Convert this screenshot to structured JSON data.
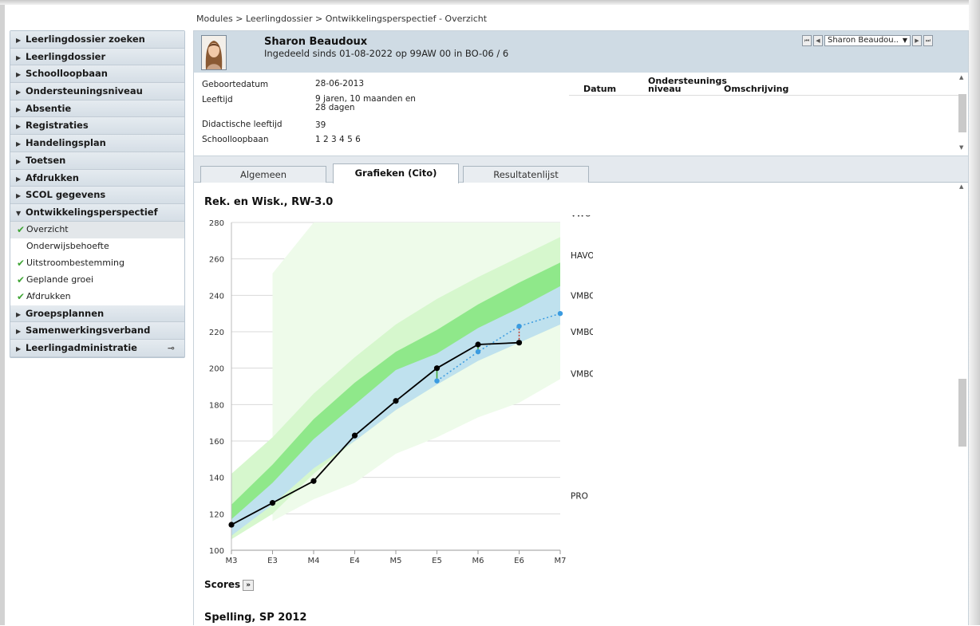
{
  "breadcrumb": "Modules > Leerlingdossier > Ontwikkelingsperspectief - Overzicht",
  "sidebar": {
    "items_top": [
      "Leerlingdossier zoeken",
      "Leerlingdossier",
      "Schoolloopbaan",
      "Ondersteuningsniveau",
      "Absentie",
      "Registraties",
      "Handelingsplan",
      "Toetsen",
      "Afdrukken",
      "SCOL gegevens"
    ],
    "expanded": "Ontwikkelingsperspectief",
    "sub_items": [
      {
        "label": "Overzicht",
        "checked": true,
        "active": true
      },
      {
        "label": "Onderwijsbehoefte",
        "checked": false,
        "active": false
      },
      {
        "label": "Uitstroombestemming",
        "checked": true,
        "active": false
      },
      {
        "label": "Geplande groei",
        "checked": true,
        "active": false
      },
      {
        "label": "Afdrukken",
        "checked": true,
        "active": false
      }
    ],
    "items_bottom": [
      "Groepsplannen",
      "Samenwerkingsverband",
      "Leerlingadministratie"
    ]
  },
  "student": {
    "name": "Sharon Beaudoux",
    "subtitle": "Ingedeeld sinds 01-08-2022 op 99AW 00 in BO-06 / 6",
    "select_value": "Sharon Beaudou.."
  },
  "info": {
    "labels": [
      "Geboortedatum",
      "Leeftijd",
      "Didactische leeftijd",
      "Schoolloopbaan"
    ],
    "birthdate": "28-06-2013",
    "age_line1": "9 jaren, 10 maanden en",
    "age_line2": "28 dagen",
    "didactic_age": "39",
    "school_career": "1 2 3 4 5 6",
    "col_datum": "Datum",
    "col_niveau_1": "Ondersteunings",
    "col_niveau_2": "niveau",
    "col_omschrijving": "Omschrijving"
  },
  "tabs": [
    "Algemeen",
    "Grafieken (Cito)",
    "Resultatenlijst"
  ],
  "active_tab": "Grafieken (Cito)",
  "chart1_title": "Rek. en Wisk., RW-3.0",
  "chart2_title": "Spelling, SP 2012",
  "scores_label": "Scores",
  "chart_data": {
    "type": "line",
    "title": "Rek. en Wisk., RW-3.0",
    "categories": [
      "M3",
      "E3",
      "M4",
      "E4",
      "M5",
      "E5",
      "M6",
      "E6",
      "M7"
    ],
    "ylim": [
      100,
      280
    ],
    "yticks": [
      100,
      120,
      140,
      160,
      180,
      200,
      220,
      240,
      260,
      280
    ],
    "grid": true,
    "level_labels": [
      "VWO",
      "HAVO",
      "VMBO-G/T",
      "VMBO-B/K",
      "VMBO-B",
      "PRO"
    ],
    "series": [
      {
        "values": [
          114,
          126,
          138,
          163,
          182,
          200,
          213,
          214,
          null
        ]
      },
      {
        "values": [
          null,
          null,
          null,
          null,
          null,
          193,
          209,
          223,
          230
        ]
      }
    ],
    "bands": [
      {
        "lower": [
          null,
          116,
          128,
          137,
          153,
          162,
          173,
          181,
          194
        ],
        "upper": [
          226,
          252,
          280,
          280,
          280,
          280,
          280,
          280,
          280
        ],
        "color": "#eefbea"
      },
      {
        "lower": [
          106,
          120,
          142,
          160,
          177,
          191,
          204,
          214,
          224
        ],
        "upper": [
          142,
          162,
          186,
          206,
          224,
          238,
          250,
          261,
          272
        ],
        "color": "#d6f7cd"
      },
      {
        "lower": [
          108,
          126,
          150,
          166,
          186,
          200,
          210,
          220,
          232
        ],
        "upper": [
          125,
          147,
          172,
          192,
          209,
          221,
          235,
          247,
          258
        ],
        "color": "#8fe88a"
      },
      {
        "lower": [
          108,
          125,
          145,
          160,
          177,
          191,
          204,
          214,
          224
        ],
        "upper": [
          117,
          137,
          161,
          180,
          199,
          208,
          222,
          233,
          245
        ],
        "color": "#bfe1ee"
      }
    ],
    "colors": {
      "student": "#000000",
      "planned": "#3a9be0"
    }
  }
}
